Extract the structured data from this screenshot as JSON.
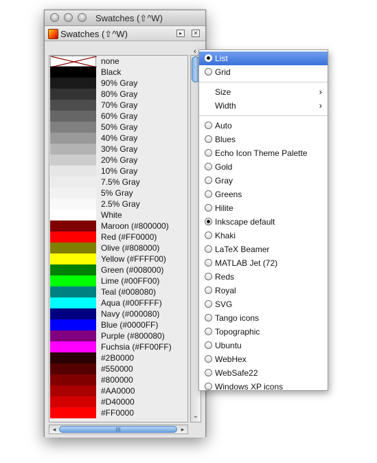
{
  "window": {
    "title": "Swatches (⇧^W)"
  },
  "dock": {
    "title": "Swatches (⇧^W)",
    "btn_menu": "▸",
    "btn_close": "✕"
  },
  "swatches": [
    {
      "label": "none",
      "color": "none"
    },
    {
      "label": "Black",
      "color": "#000000"
    },
    {
      "label": "90% Gray",
      "color": "#1a1a1a"
    },
    {
      "label": "80% Gray",
      "color": "#333333"
    },
    {
      "label": "70% Gray",
      "color": "#4d4d4d"
    },
    {
      "label": "60% Gray",
      "color": "#666666"
    },
    {
      "label": "50% Gray",
      "color": "#808080"
    },
    {
      "label": "40% Gray",
      "color": "#999999"
    },
    {
      "label": "30% Gray",
      "color": "#b3b3b3"
    },
    {
      "label": "20% Gray",
      "color": "#cccccc"
    },
    {
      "label": "10% Gray",
      "color": "#e6e6e6"
    },
    {
      "label": "7.5% Gray",
      "color": "#ececec"
    },
    {
      "label": "5% Gray",
      "color": "#f2f2f2"
    },
    {
      "label": "2.5% Gray",
      "color": "#f9f9f9"
    },
    {
      "label": "White",
      "color": "#ffffff"
    },
    {
      "label": "Maroon (#800000)",
      "color": "#800000"
    },
    {
      "label": "Red (#FF0000)",
      "color": "#ff0000"
    },
    {
      "label": "Olive (#808000)",
      "color": "#808000"
    },
    {
      "label": "Yellow (#FFFF00)",
      "color": "#ffff00"
    },
    {
      "label": "Green (#008000)",
      "color": "#008000"
    },
    {
      "label": "Lime (#00FF00)",
      "color": "#00ff00"
    },
    {
      "label": "Teal (#008080)",
      "color": "#008080"
    },
    {
      "label": "Aqua (#00FFFF)",
      "color": "#00ffff"
    },
    {
      "label": "Navy (#000080)",
      "color": "#000080"
    },
    {
      "label": "Blue (#0000FF)",
      "color": "#0000ff"
    },
    {
      "label": "Purple (#800080)",
      "color": "#800080"
    },
    {
      "label": "Fuchsia (#FF00FF)",
      "color": "#ff00ff"
    },
    {
      "label": "#2B0000",
      "color": "#2b0000"
    },
    {
      "label": "#550000",
      "color": "#550000"
    },
    {
      "label": "#800000",
      "color": "#800000"
    },
    {
      "label": "#AA0000",
      "color": "#aa0000"
    },
    {
      "label": "#D40000",
      "color": "#d40000"
    },
    {
      "label": "#FF0000",
      "color": "#ff0000"
    }
  ],
  "scroll": {
    "grip": "III",
    "down_arrow": "⌄",
    "left_arrow": "◂",
    "right_arrow": "▸"
  },
  "menu_anchor": "‹",
  "menu": {
    "view_items": [
      {
        "label": "List",
        "checked": true,
        "selected": true
      },
      {
        "label": "Grid",
        "checked": false,
        "selected": false
      }
    ],
    "submenus": [
      {
        "label": "Size",
        "arrow": "›"
      },
      {
        "label": "Width",
        "arrow": "›"
      }
    ],
    "palettes": [
      {
        "label": "Auto",
        "checked": false
      },
      {
        "label": "Blues",
        "checked": false
      },
      {
        "label": "Echo Icon Theme Palette",
        "checked": false
      },
      {
        "label": "Gold",
        "checked": false
      },
      {
        "label": "Gray",
        "checked": false
      },
      {
        "label": "Greens",
        "checked": false
      },
      {
        "label": "Hilite",
        "checked": false
      },
      {
        "label": "Inkscape default",
        "checked": true
      },
      {
        "label": "Khaki",
        "checked": false
      },
      {
        "label": "LaTeX Beamer",
        "checked": false
      },
      {
        "label": "MATLAB Jet (72)",
        "checked": false
      },
      {
        "label": "Reds",
        "checked": false
      },
      {
        "label": "Royal",
        "checked": false
      },
      {
        "label": "SVG",
        "checked": false
      },
      {
        "label": "Tango icons",
        "checked": false
      },
      {
        "label": "Topographic",
        "checked": false
      },
      {
        "label": "Ubuntu",
        "checked": false
      },
      {
        "label": "WebHex",
        "checked": false
      },
      {
        "label": "WebSafe22",
        "checked": false
      },
      {
        "label": "Windows XP icons",
        "checked": false
      }
    ]
  }
}
